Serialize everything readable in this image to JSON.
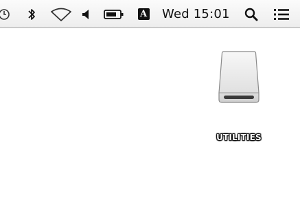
{
  "menubar": {
    "icons": [
      "clock-icon",
      "bluetooth-icon",
      "wifi-icon",
      "volume-icon",
      "battery-icon",
      "input-source-icon",
      "spotlight-icon",
      "notification-center-icon"
    ],
    "input_source_letter": "A",
    "clock": "Wed 15:01"
  },
  "desktop": {
    "volume": {
      "label": "UTILITIES",
      "icon": "external-drive-icon"
    }
  }
}
